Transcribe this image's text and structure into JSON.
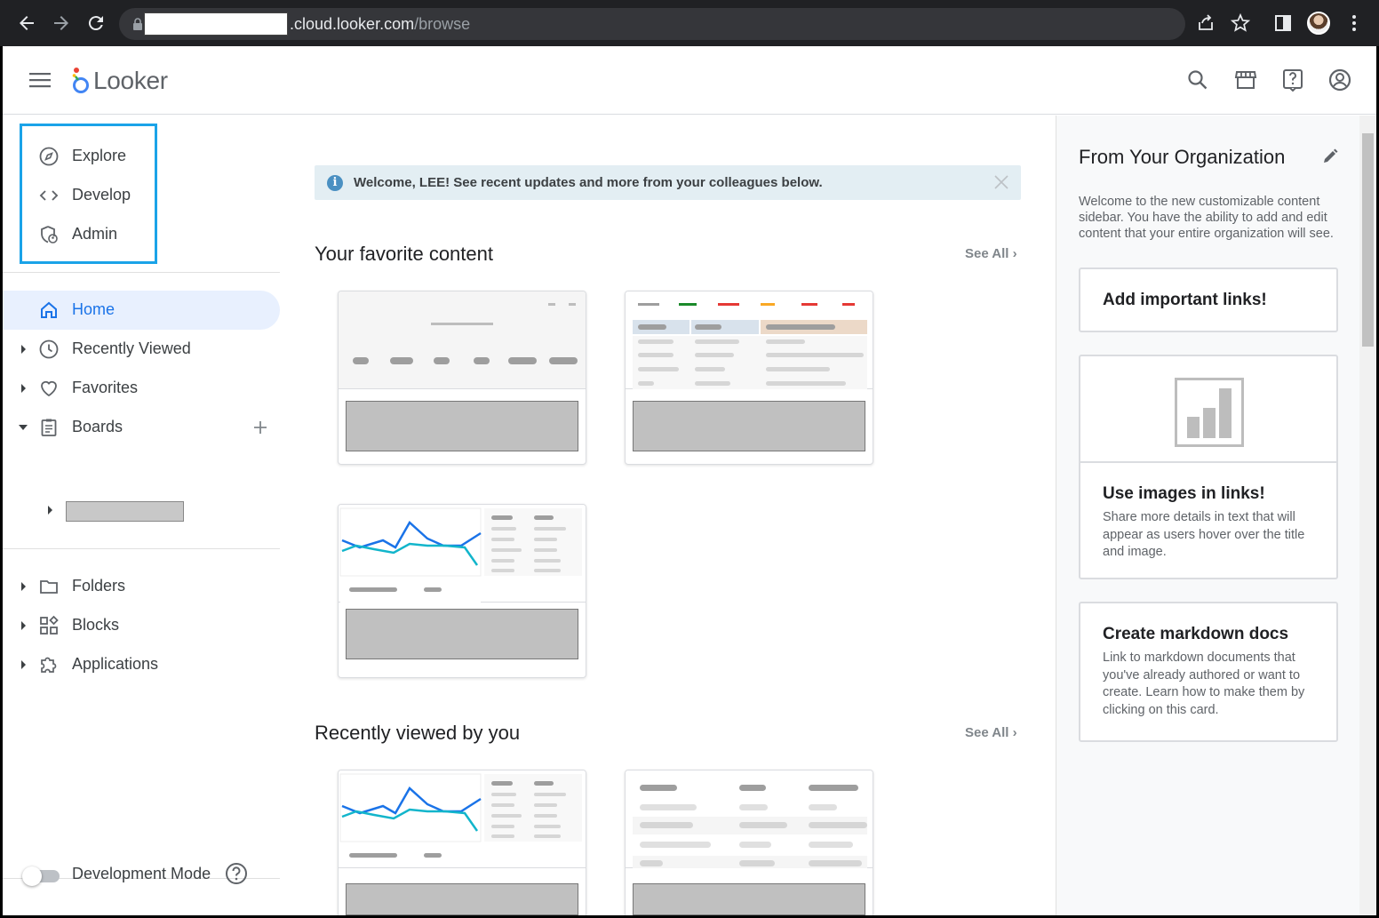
{
  "browser": {
    "url_host": ".cloud.looker.com",
    "url_path": "/browse"
  },
  "header": {
    "logo_text": "Looker"
  },
  "leftnav": {
    "top_items": [
      {
        "label": "Explore",
        "icon": "compass-icon"
      },
      {
        "label": "Develop",
        "icon": "code-icon"
      },
      {
        "label": "Admin",
        "icon": "admin-icon"
      }
    ],
    "items": [
      {
        "label": "Home",
        "icon": "home-icon",
        "active": true
      },
      {
        "label": "Recently Viewed",
        "icon": "clock-icon"
      },
      {
        "label": "Favorites",
        "icon": "heart-icon"
      },
      {
        "label": "Boards",
        "icon": "clipboard-icon",
        "expanded": true
      }
    ],
    "bottom_items": [
      {
        "label": "Folders",
        "icon": "folder-icon"
      },
      {
        "label": "Blocks",
        "icon": "blocks-icon"
      },
      {
        "label": "Applications",
        "icon": "puzzle-icon"
      }
    ],
    "dev_mode_label": "Development Mode"
  },
  "main": {
    "banner_text": "Welcome, LEE! See recent updates and more from your colleagues below.",
    "favorites_title": "Your favorite content",
    "recent_title": "Recently viewed by you",
    "see_all": "See All ›"
  },
  "sidebar": {
    "title": "From Your Organization",
    "description": "Welcome to the new customizable content sidebar. You have the ability to add and edit content that your entire organization will see.",
    "cards": [
      {
        "title": "Add important links!",
        "desc": ""
      },
      {
        "title": "Use images in links!",
        "desc": "Share more details in text that will appear as users hover over the title and image."
      },
      {
        "title": "Create markdown docs",
        "desc": "Link to markdown documents that you've already authored or want to create. Learn how to make them by clicking on this card."
      }
    ]
  },
  "colors": {
    "accent": "#1a73e8",
    "highlight_box": "#1aa3e8",
    "banner_bg": "#e3eef3"
  }
}
